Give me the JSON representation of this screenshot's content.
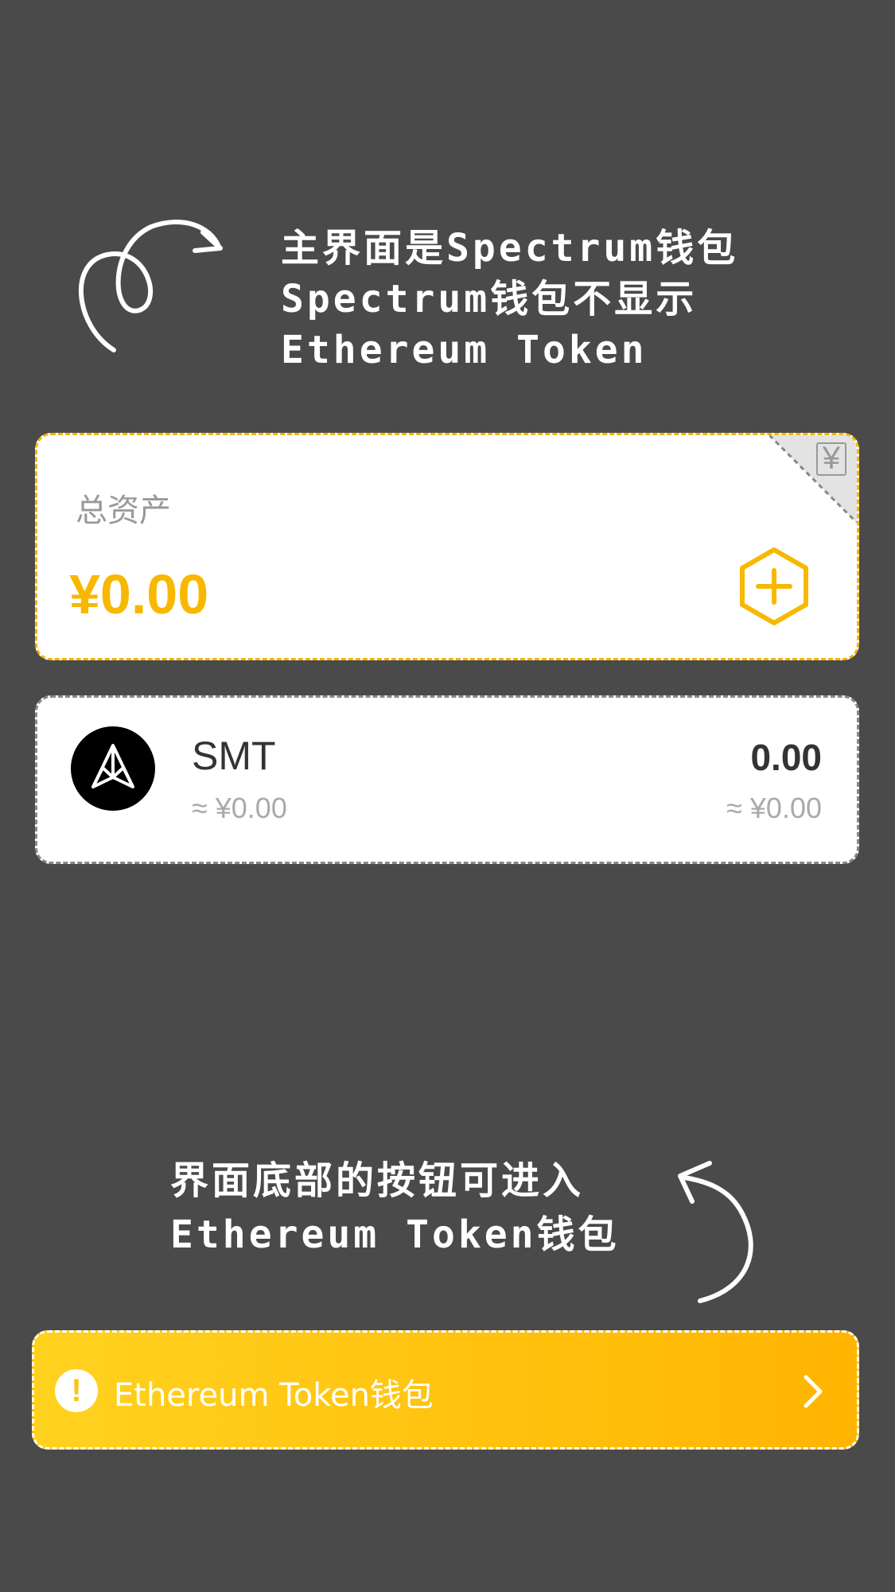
{
  "annotations": {
    "top_lines": [
      "主界面是Spectrum钱包",
      "Spectrum钱包不显示",
      "Ethereum Token"
    ],
    "bottom_lines": [
      "界面底部的按钮可进入",
      "Ethereum Token钱包"
    ]
  },
  "assets": {
    "label": "总资产",
    "amount": "¥0.00",
    "corner_icon": "yen-currency-icon",
    "add_icon": "hexagon-plus-icon"
  },
  "token": {
    "symbol": "SMT",
    "balance": "0.00",
    "fiat_left": "≈ ¥0.00",
    "fiat_right": "≈ ¥0.00",
    "logo_icon": "smt-logo-icon"
  },
  "eth_button": {
    "label": "Ethereum Token钱包",
    "warn_glyph": "!",
    "warn_icon": "exclamation-circle-icon",
    "chevron_icon": "chevron-right-icon"
  },
  "colors": {
    "background": "#4a4a4a",
    "accent": "#f8b800",
    "button_gradient_start": "#ffd21f",
    "button_gradient_end": "#ffb400"
  }
}
